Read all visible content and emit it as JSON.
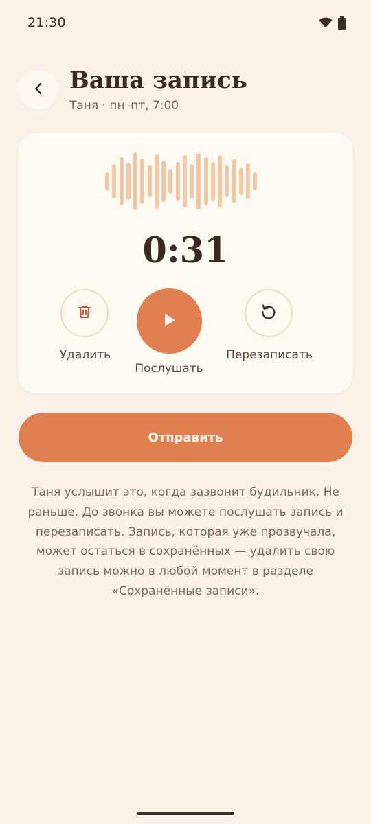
{
  "status_bar": {
    "time": "21:30",
    "icons": [
      "wifi-icon",
      "battery-icon"
    ]
  },
  "header": {
    "back_icon": "chevron-left-icon",
    "title": "Ваша запись",
    "subtitle": "Таня · пн–пт, 7:00"
  },
  "player": {
    "duration": "0:31",
    "actions": {
      "delete_label": "Удалить",
      "play_label": "Послушать",
      "rerecord_label": "Перезаписать"
    },
    "icons": {
      "delete": "trash-icon",
      "play": "play-icon",
      "rerecord": "rotate-ccw-icon"
    }
  },
  "send_button": {
    "label": "Отправить"
  },
  "info_text": "Таня услышит это, когда зазвонит будильник. Не раньше. До звонка вы можете послушать запись и перезаписать. Запись, которая уже прозвучала, может остаться в сохранённых — удалить свою запись можно в любой момент в разделе «Сохранённые записи».",
  "colors": {
    "background": "#FAF1E8",
    "card": "#FFFAF2",
    "accent": "#E07F4F",
    "waveform": "#F1C7A8",
    "delete_icon": "#C4573F",
    "text_primary": "#3A2A22",
    "text_secondary": "#7A685C"
  }
}
